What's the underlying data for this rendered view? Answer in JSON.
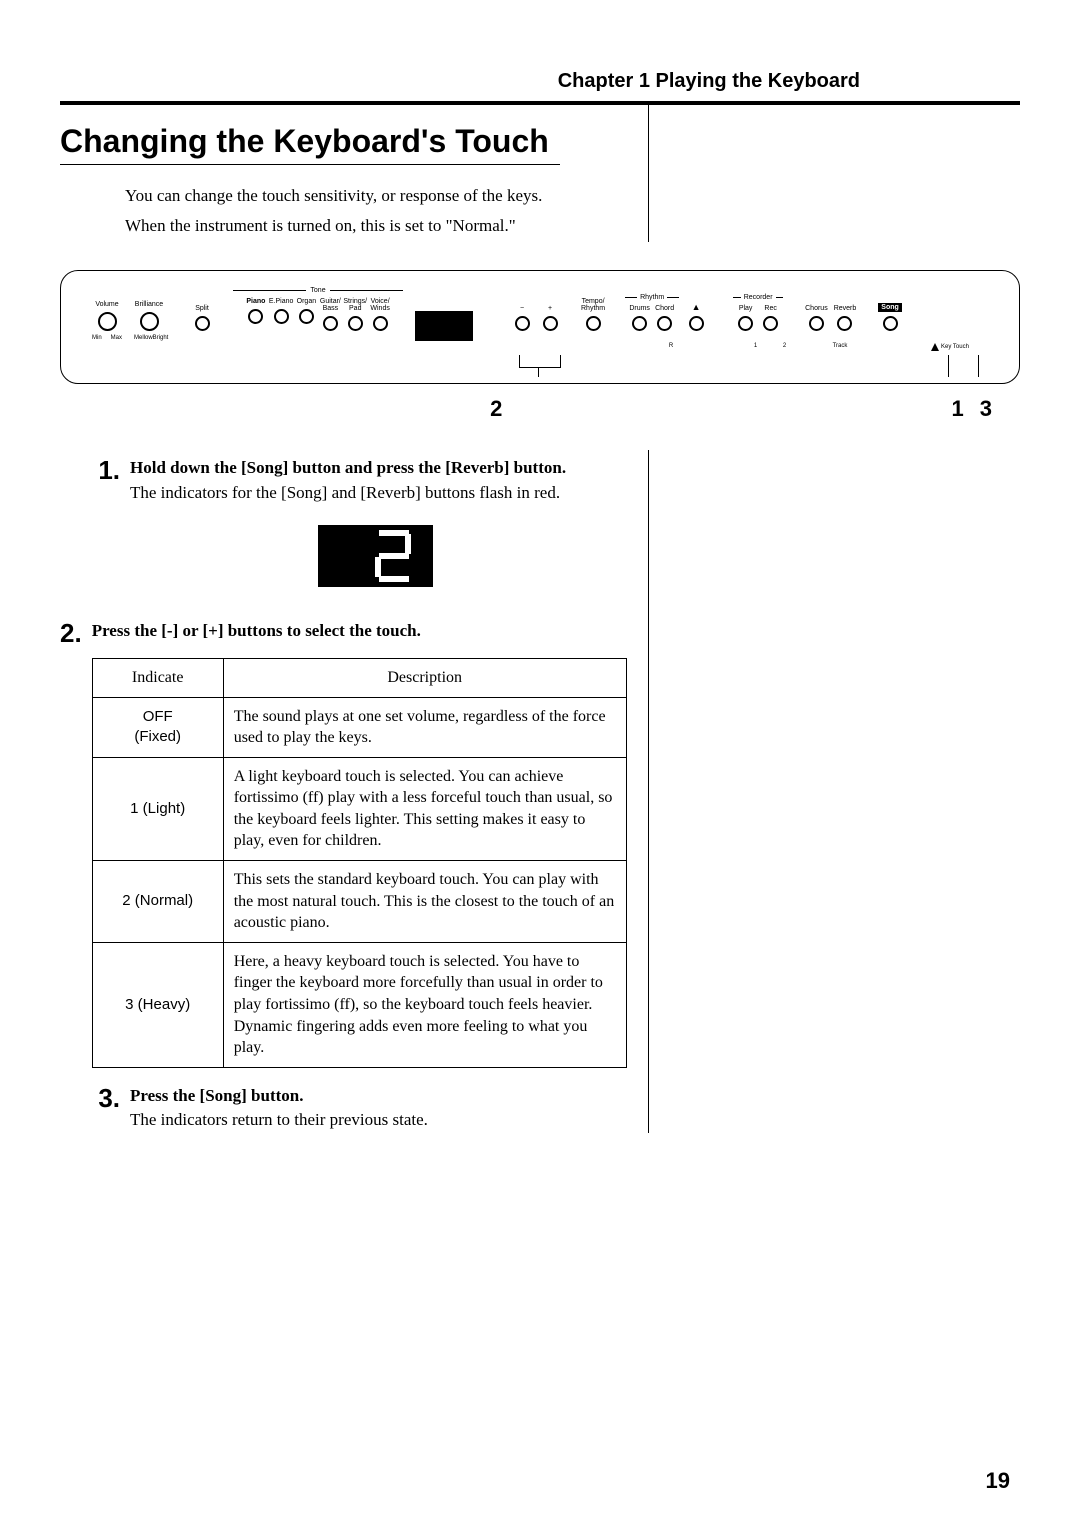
{
  "chapter": "Chapter 1 Playing the Keyboard",
  "heading": "Changing the Keyboard's Touch",
  "intro": [
    "You can change the touch sensitivity, or response of the keys.",
    "When the instrument is turned on, this is set to \"Normal.\""
  ],
  "panel": {
    "knobs": {
      "volume": {
        "label": "Volume",
        "bottom_left": "Min",
        "bottom_right": "Max"
      },
      "brilliance": {
        "label": "Brilliance",
        "bottom_left": "Mellow",
        "bottom_right": "Bright"
      }
    },
    "split": "Split",
    "tone_group_label": "Tone",
    "tone": [
      "Piano",
      "E.Piano",
      "Organ",
      "Guitar/\nBass",
      "Strings/\nPad",
      "Voice/\nWinds"
    ],
    "minus": "−",
    "plus": "+",
    "tempo": "Tempo/\nRhythm",
    "rhythm_group_label": "Rhythm",
    "rhythm": [
      "Drums",
      "Chord"
    ],
    "metronome_icon": "metronome-icon",
    "recorder_group_label": "Recorder",
    "recorder": [
      "Play",
      "Rec"
    ],
    "chorus": "Chorus",
    "reverb": "Reverb",
    "song": "Song",
    "track_labels": {
      "r": "R",
      "one": "1",
      "two": "2",
      "track": "Track"
    },
    "keytouch": "Key Touch",
    "callouts": {
      "below_plusminus": "2",
      "below_reverb": "1",
      "below_song": "3"
    }
  },
  "steps": [
    {
      "num": "1.",
      "title": "Hold down the [Song] button and press the [Reverb] button.",
      "body": "The indicators for the [Song] and [Reverb] buttons flash in red."
    },
    {
      "num": "2.",
      "title": "Press the [-] or [+] buttons to select the touch."
    },
    {
      "num": "3.",
      "title": "Press the [Song] button.",
      "body": "The indicators return to their previous state."
    }
  ],
  "display_value": "2",
  "touch_table": {
    "headers": {
      "indicate": "Indicate",
      "description": "Description"
    },
    "rows": [
      {
        "indicate": "OFF\n(Fixed)",
        "desc": "The sound plays at one set volume, regardless of the force used to play the keys."
      },
      {
        "indicate": "1 (Light)",
        "desc": "A light keyboard touch is selected. You can achieve fortissimo (ff) play with a less forceful touch than usual, so the keyboard feels lighter. This setting makes it easy to play, even for children."
      },
      {
        "indicate": "2 (Normal)",
        "desc": "This sets the standard keyboard touch. You can play with the most natural touch. This is the closest to the touch of an acoustic piano."
      },
      {
        "indicate": "3 (Heavy)",
        "desc": "Here, a heavy keyboard touch is selected. You have to finger the keyboard more forcefully than usual in order to play fortissimo (ff), so the keyboard touch feels heavier. Dynamic fingering adds even more feeling to what you play."
      }
    ]
  },
  "page_number": "19"
}
